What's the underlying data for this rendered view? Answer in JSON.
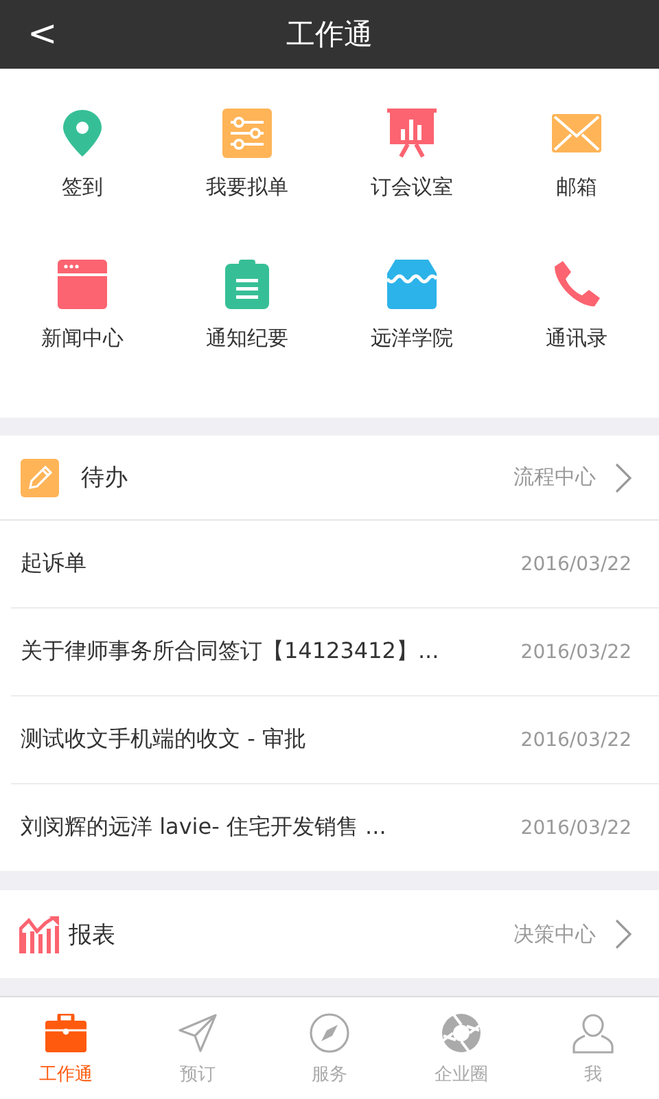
{
  "header": {
    "back": "<",
    "title": "工作通"
  },
  "apps": [
    {
      "kind": "pin",
      "label": "签到"
    },
    {
      "kind": "sliders",
      "label": "我要拟单"
    },
    {
      "kind": "board",
      "label": "订会议室"
    },
    {
      "kind": "mail",
      "label": "邮箱"
    },
    {
      "kind": "window",
      "label": "新闻中心"
    },
    {
      "kind": "clipboard",
      "label": "通知纪要"
    },
    {
      "kind": "store",
      "label": "远洋学院"
    },
    {
      "kind": "phone",
      "label": "通讯录"
    }
  ],
  "todo": {
    "title": "待办",
    "link": "流程中心",
    "items": [
      {
        "title": "起诉单",
        "date": "2016/03/22"
      },
      {
        "title": "关于律师事务所合同签订【14123412】...",
        "date": "2016/03/22"
      },
      {
        "title": "测试收文手机端的收文 - 审批",
        "date": "2016/03/22"
      },
      {
        "title": "刘闵辉的远洋 lavie- 住宅开发销售 ...",
        "date": "2016/03/22"
      }
    ]
  },
  "report": {
    "title": "报表",
    "link": "决策中心"
  },
  "tabs": [
    {
      "kind": "briefcase",
      "label": "工作通",
      "selected": true
    },
    {
      "kind": "plane",
      "label": "预订",
      "selected": false
    },
    {
      "kind": "compass",
      "label": "服务",
      "selected": false
    },
    {
      "kind": "aperture",
      "label": "企业圈",
      "selected": false
    },
    {
      "kind": "person",
      "label": "我",
      "selected": false
    }
  ]
}
